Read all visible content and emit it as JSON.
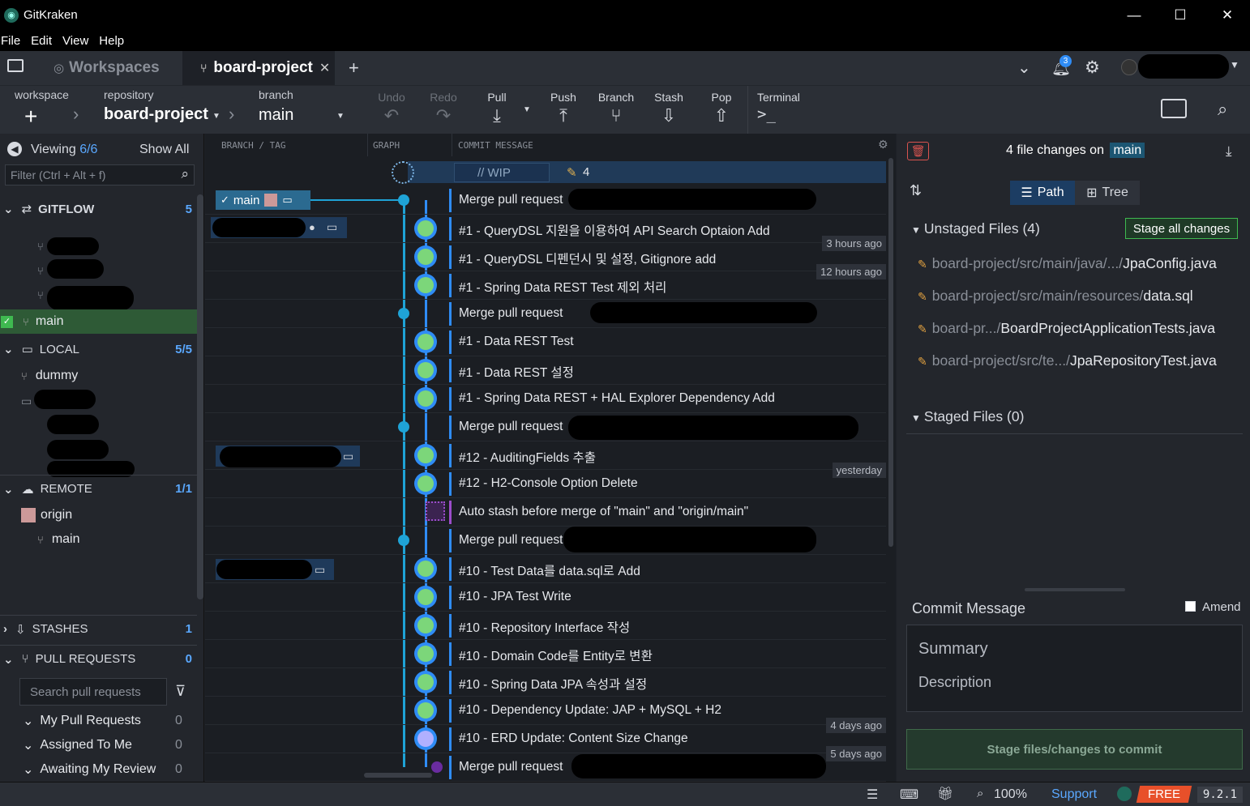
{
  "app": {
    "title": "GitKraken",
    "version": "9.2.1"
  },
  "menu": [
    "File",
    "Edit",
    "View",
    "Help"
  ],
  "tabs": {
    "workspaces": "Workspaces",
    "active": "board-project",
    "notifications": "3"
  },
  "toolbar": {
    "workspace_label": "workspace",
    "repository_label": "repository",
    "repository": "board-project",
    "branch_label": "branch",
    "branch": "main",
    "undo": "Undo",
    "redo": "Redo",
    "pull": "Pull",
    "push": "Push",
    "branch_btn": "Branch",
    "stash": "Stash",
    "pop": "Pop",
    "terminal": "Terminal"
  },
  "left": {
    "viewing": "Viewing",
    "viewing_count": "6/6",
    "show_all": "Show All",
    "filter_placeholder": "Filter (Ctrl + Alt + f)",
    "gitflow": "GITFLOW",
    "gitflow_count": "5",
    "main_branch": "main",
    "local": "LOCAL",
    "local_count": "5/5",
    "dummy": "dummy",
    "remote": "REMOTE",
    "remote_count": "1/1",
    "origin": "origin",
    "origin_main": "main",
    "stashes": "STASHES",
    "stashes_count": "1",
    "pull_requests": "PULL REQUESTS",
    "pr_count": "0",
    "search_pr_placeholder": "Search pull requests",
    "my_pr": "My Pull Requests",
    "my_pr_count": "0",
    "assigned": "Assigned To Me",
    "assigned_count": "0",
    "awaiting": "Awaiting My Review",
    "awaiting_count": "0"
  },
  "graph": {
    "col_branch": "BRANCH / TAG",
    "col_graph": "GRAPH",
    "col_message": "COMMIT MESSAGE",
    "wip": "// WIP",
    "wip_count": "4",
    "branch_tag": "main",
    "commits": [
      {
        "msg": "Merge pull request",
        "type": "merge"
      },
      {
        "msg": "#1 - QueryDSL 지원을 이용하여 API Search Optaion Add",
        "type": "avatar"
      },
      {
        "msg": "#1 - QueryDSL 디펜던시 및 설정, Gitignore add",
        "type": "avatar",
        "time": "3 hours ago"
      },
      {
        "msg": "#1 - Spring Data REST Test 제외 처리",
        "type": "avatar",
        "time": "12 hours ago"
      },
      {
        "msg": "Merge pull request",
        "type": "merge"
      },
      {
        "msg": "#1 - Data REST Test",
        "type": "avatar"
      },
      {
        "msg": "#1 - Data REST 설정",
        "type": "avatar"
      },
      {
        "msg": "#1 - Spring Data REST + HAL Explorer Dependency Add",
        "type": "avatar"
      },
      {
        "msg": "Merge pull request",
        "type": "merge"
      },
      {
        "msg": "#12 - AuditingFields 추출",
        "type": "avatar"
      },
      {
        "msg": "#12 - H2-Console Option Delete",
        "type": "avatar",
        "time": "yesterday"
      },
      {
        "msg": "Auto stash before merge of \"main\" and \"origin/main\"",
        "type": "stash"
      },
      {
        "msg": "Merge pull request",
        "type": "merge"
      },
      {
        "msg": "#10 - Test Data를 data.sql로 Add",
        "type": "avatar"
      },
      {
        "msg": "#10 - JPA Test Write",
        "type": "avatar"
      },
      {
        "msg": "#10 - Repository Interface 작성",
        "type": "avatar"
      },
      {
        "msg": "#10 - Domain Code를 Entity로 변환",
        "type": "avatar"
      },
      {
        "msg": "#10 - Spring Data JPA 속성과 설정",
        "type": "avatar"
      },
      {
        "msg": "#10 - Dependency Update: JAP + MySQL + H2",
        "type": "avatar"
      },
      {
        "msg": "#10 - ERD Update: Content Size Change",
        "type": "avatar2",
        "time": "4 days ago"
      },
      {
        "msg": "Merge pull request",
        "type": "merge2",
        "time": "5 days ago"
      }
    ]
  },
  "right": {
    "header_prefix": "4 file changes on",
    "header_branch": "main",
    "path": "Path",
    "tree": "Tree",
    "unstaged": "Unstaged Files (4)",
    "stage_all": "Stage all changes",
    "files": [
      {
        "dim": "board-project/src/main/java/.../",
        "name": "JpaConfig.java"
      },
      {
        "dim": "board-project/src/main/resources/",
        "name": "data.sql"
      },
      {
        "dim": "board-pr.../",
        "name": "BoardProjectApplicationTests.java"
      },
      {
        "dim": "board-project/src/te.../",
        "name": "JpaRepositoryTest.java"
      }
    ],
    "staged": "Staged Files (0)",
    "commit_message": "Commit Message",
    "amend": "Amend",
    "summary_placeholder": "Summary",
    "description_placeholder": "Description",
    "commit_button": "Stage files/changes to commit"
  },
  "status": {
    "zoom": "100%",
    "support": "Support",
    "free": "FREE",
    "version": "9.2.1"
  }
}
